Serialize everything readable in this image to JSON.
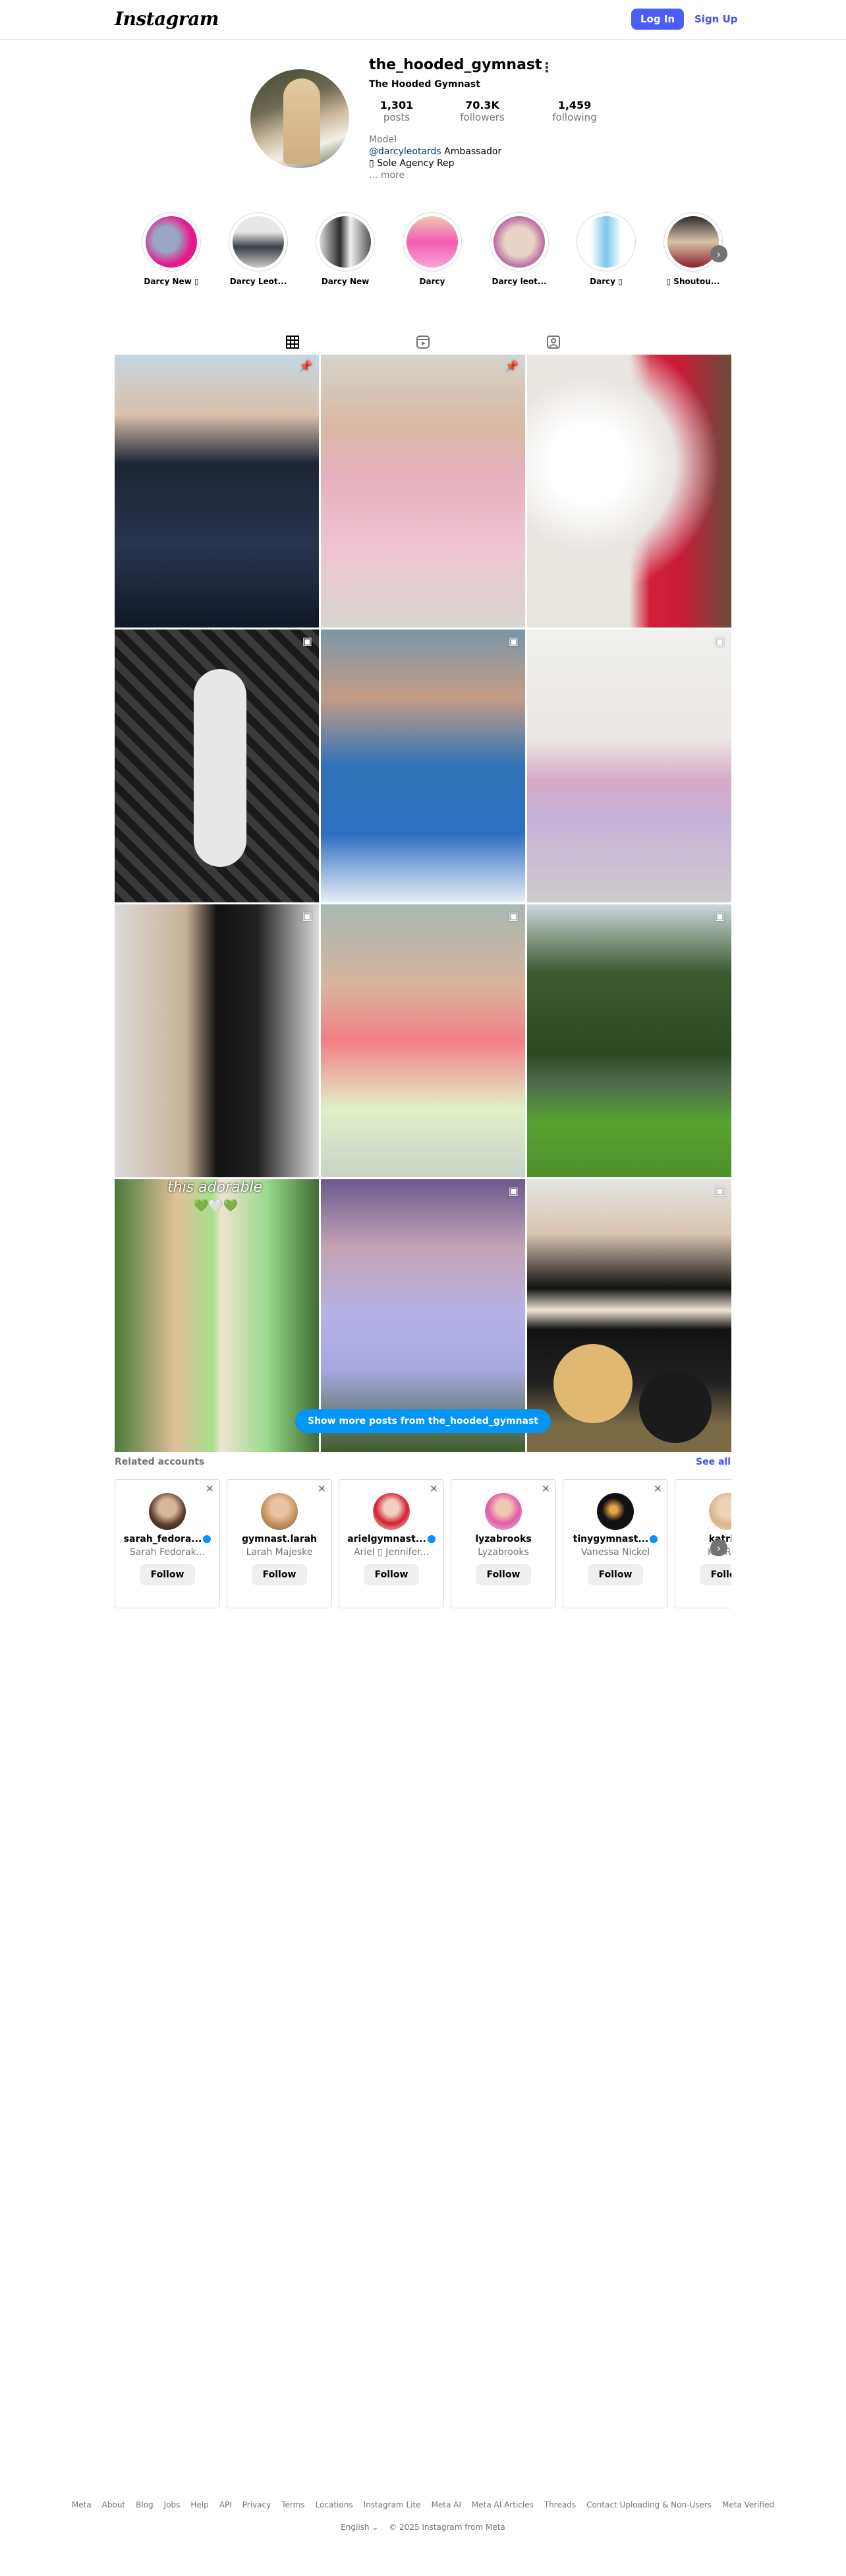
{
  "header": {
    "logo": "Instagram",
    "login_label": "Log In",
    "signup_label": "Sign Up"
  },
  "profile": {
    "username": "the_hooded_gymnast",
    "full_name": "The Hooded Gymnast",
    "stats": [
      {
        "num": "1,301",
        "label": "posts"
      },
      {
        "num": "70.3K",
        "label": "followers"
      },
      {
        "num": "1,459",
        "label": "following"
      }
    ],
    "category": "Model",
    "bio_mention": "@darcyleotards",
    "bio_mention_suffix": " Ambassador",
    "bio_line2": "▯ Sole Agency Rep",
    "more": "... more"
  },
  "highlights": [
    {
      "label": "Darcy New ▯"
    },
    {
      "label": "Darcy Leot..."
    },
    {
      "label": "Darcy New"
    },
    {
      "label": "Darcy"
    },
    {
      "label": "Darcy leot..."
    },
    {
      "label": "Darcy ▯"
    },
    {
      "label": "▯ Shoutou..."
    }
  ],
  "tabs": [
    "grid-icon",
    "reels-icon",
    "tagged-icon"
  ],
  "show_more": "Show more posts from the_hooded_gymnast",
  "post_overlay_text": "this adorable",
  "related": {
    "title": "Related accounts",
    "see_all": "See all",
    "accounts": [
      {
        "user": "sarah_fedora...",
        "name": "Sarah Fedorak...",
        "verified": true
      },
      {
        "user": "gymnast.larah",
        "name": "Larah Majeske",
        "verified": false
      },
      {
        "user": "arielgymnast...",
        "name": "Ariel ▯ Jennifer...",
        "verified": true
      },
      {
        "user": "lyzabrooks",
        "name": "Lyzabrooks",
        "verified": false
      },
      {
        "user": "tinygymnast...",
        "name": "Vanessa Nickel",
        "verified": true
      },
      {
        "user": "katrina",
        "name": "KATRINA",
        "verified": false
      }
    ],
    "follow_label": "Follow"
  },
  "footer": {
    "links": [
      "Meta",
      "About",
      "Blog",
      "Jobs",
      "Help",
      "API",
      "Privacy",
      "Terms",
      "Locations",
      "Instagram Lite",
      "Meta AI",
      "Meta AI Articles",
      "Threads",
      "Contact Uploading & Non-Users",
      "Meta Verified"
    ],
    "language": "English ⌄",
    "copyright": "© 2025 Instagram from Meta"
  }
}
